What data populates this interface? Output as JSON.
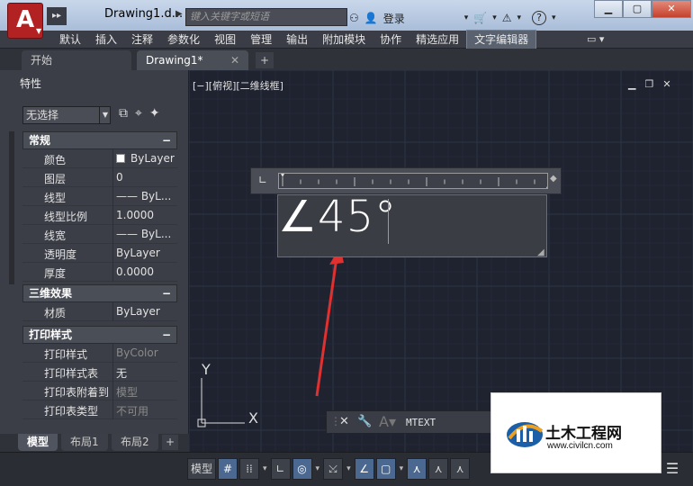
{
  "window": {
    "title": "Drawing1.d...",
    "search_placeholder": "键入关键字或短语",
    "login_label": "登录"
  },
  "menu": {
    "items": [
      "默认",
      "插入",
      "注释",
      "参数化",
      "视图",
      "管理",
      "输出",
      "附加模块",
      "协作",
      "精选应用",
      "文字编辑器"
    ],
    "active_index": 10
  },
  "doc_tabs": {
    "tabs": [
      "开始",
      "Drawing1*"
    ],
    "active_index": 1
  },
  "palette": {
    "title": "特性",
    "selection": "无选择",
    "sections": [
      {
        "name": "常规",
        "rows": [
          {
            "label": "颜色",
            "value": "ByLayer"
          },
          {
            "label": "图层",
            "value": "0"
          },
          {
            "label": "线型",
            "value": "—— ByL..."
          },
          {
            "label": "线型比例",
            "value": "1.0000"
          },
          {
            "label": "线宽",
            "value": "—— ByL..."
          },
          {
            "label": "透明度",
            "value": "ByLayer"
          },
          {
            "label": "厚度",
            "value": "0.0000"
          }
        ]
      },
      {
        "name": "三维效果",
        "rows": [
          {
            "label": "材质",
            "value": "ByLayer"
          }
        ]
      },
      {
        "name": "打印样式",
        "rows": [
          {
            "label": "打印样式",
            "value": "ByColor"
          },
          {
            "label": "打印样式表",
            "value": "无"
          },
          {
            "label": "打印表附着到",
            "value": "模型"
          },
          {
            "label": "打印表类型",
            "value": "不可用"
          }
        ]
      }
    ]
  },
  "layout_tabs": {
    "tabs": [
      "模型",
      "布局1",
      "布局2"
    ],
    "active_index": 0
  },
  "viewport": {
    "label": "[−][俯视][二维线框]",
    "ucs_x": "X",
    "ucs_y": "Y"
  },
  "mtext": {
    "value": "∠45°"
  },
  "command": {
    "text": "MTEXT"
  },
  "statusbar": {
    "model_label": "模型"
  },
  "watermark": {
    "title": "土木工程网",
    "url": "www.civilcn.com"
  },
  "colors": {
    "viewport_bg": "#1f2330",
    "accent_red": "#e03030",
    "autocad_red": "#b32222"
  }
}
